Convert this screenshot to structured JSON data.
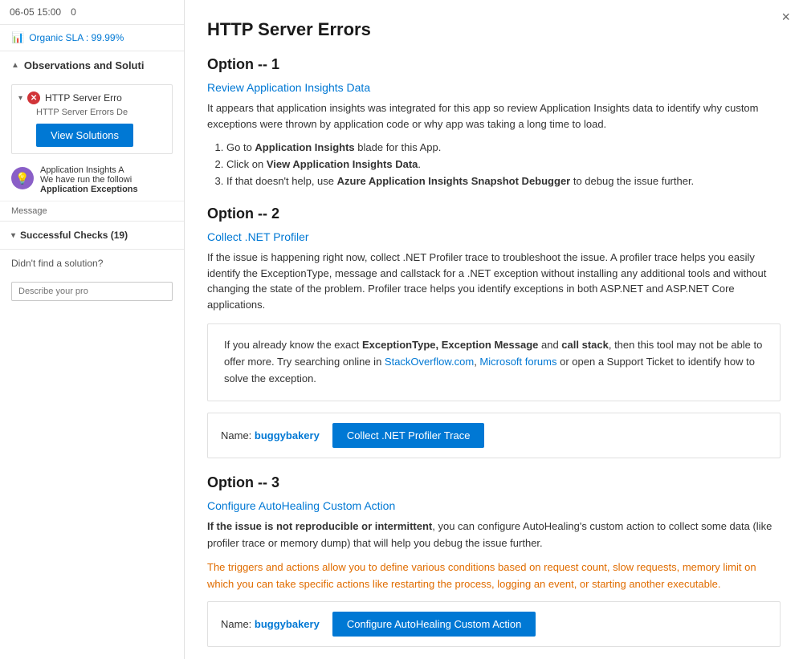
{
  "left": {
    "top_bar": {
      "date1": "06-05 15:00",
      "date2": "0"
    },
    "organic_sla": {
      "label": "Organic SLA : 99.99%",
      "icon": "📊"
    },
    "observations_section": {
      "label": "Observations and Soluti",
      "chevron": "▲"
    },
    "obs_item": {
      "chevron": "▾",
      "title": "HTTP Server Erro",
      "desc": "HTTP Server Errors De",
      "button_label": "View Solutions"
    },
    "insights_item": {
      "icon": "💡",
      "title": "Application Insights A",
      "desc1": "We have run the followi",
      "desc2": "Application Exceptions"
    },
    "message_label": "Message",
    "successful_checks": {
      "chevron": "▾",
      "label": "Successful Checks (19)"
    },
    "didnt_find": "Didn't find a solution?",
    "describe_placeholder": "Describe your pro"
  },
  "right": {
    "close_label": "×",
    "title": "HTTP Server Errors",
    "option1": {
      "heading": "Option -- 1",
      "subheading": "Review Application Insights Data",
      "desc": "It appears that application insights was integrated for this app so review Application Insights data to identify why custom exceptions were thrown by application code or why app was taking a long time to load.",
      "steps": [
        {
          "text": "Go to ",
          "bold": "Application Insights",
          "rest": " blade for this App."
        },
        {
          "text": "Click on ",
          "bold": "View Application Insights Data",
          "rest": "."
        },
        {
          "text": "If that doesn't help, use ",
          "bold": "Azure Application Insights Snapshot Debugger",
          "rest": " to debug the issue further."
        }
      ]
    },
    "option2": {
      "heading": "Option -- 2",
      "subheading": "Collect .NET Profiler",
      "desc": "If the issue is happening right now, collect .NET Profiler trace to troubleshoot the issue. A profiler trace helps you easily identify the ExceptionType, message and callstack for a .NET exception without installing any additional tools and without changing the state of the problem. Profiler trace helps you identify exceptions in both ASP.NET and ASP.NET Core applications.",
      "callout": {
        "prefix": "If you already know the exact ",
        "bold1": "ExceptionType, Exception Message",
        "mid1": " and ",
        "bold2": "call stack",
        "mid2": ", then this tool may not be able to offer more. Try searching online in ",
        "link1": "StackOverflow.com",
        "mid3": ", ",
        "link2": "Microsoft forums",
        "suffix": " or open a Support Ticket to identify how to solve the exception."
      },
      "action": {
        "name_label": "Name:",
        "name_value": "buggybakery",
        "button_label": "Collect .NET Profiler Trace"
      }
    },
    "option3": {
      "heading": "Option -- 3",
      "subheading": "Configure AutoHealing Custom Action",
      "desc1_bold": "If the issue is not reproducible or intermittent",
      "desc1_rest": ", you can configure AutoHealing's custom action to collect some data (like profiler trace or memory dump) that will help you debug the issue further.",
      "desc2": "The triggers and actions allow you to define various conditions based on request count, slow requests, memory limit on which you can take specific actions like restarting the process, logging an event, or starting another executable.",
      "action": {
        "name_label": "Name:",
        "name_value": "buggybakery",
        "button_label": "Configure AutoHealing Custom Action"
      }
    }
  }
}
